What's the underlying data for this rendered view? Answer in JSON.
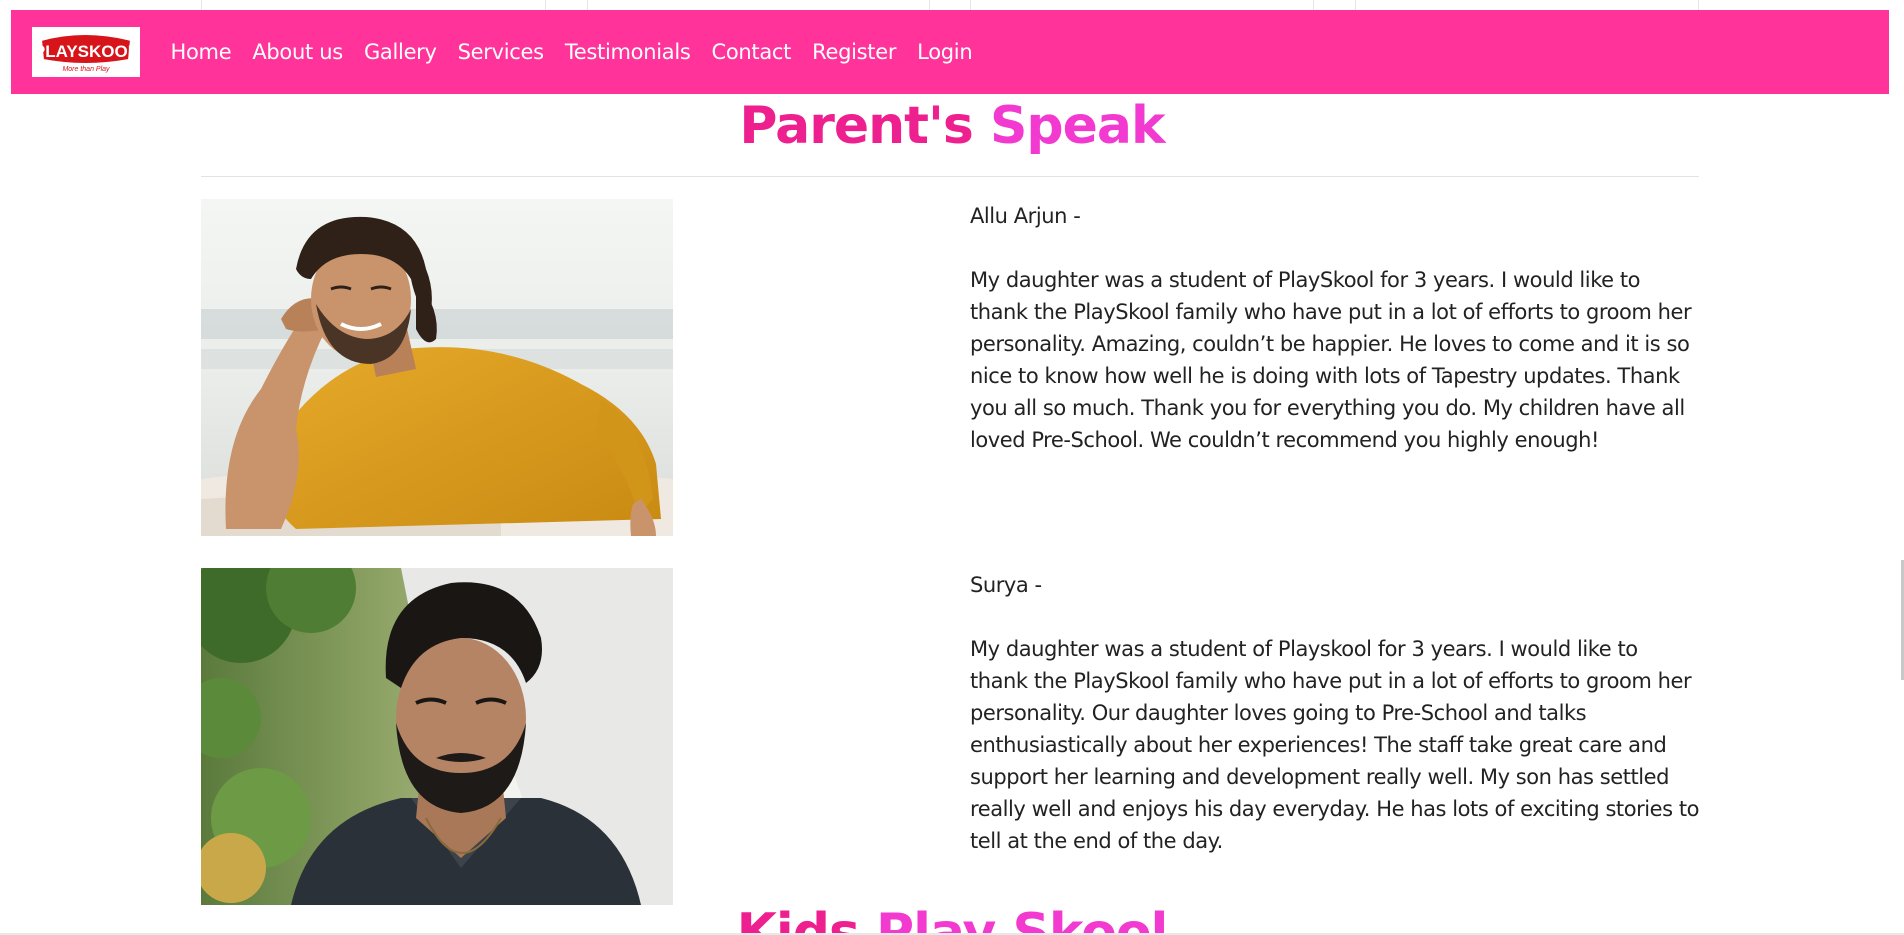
{
  "navbar": {
    "logo_text": "PLAYSKOOL",
    "logo_tagline": "More than Play",
    "links": [
      "Home",
      "About us",
      "Gallery",
      "Services",
      "Testimonials",
      "Contact",
      "Register",
      "Login"
    ]
  },
  "testimonials_section": {
    "title_main": "Parent's",
    "title_accent": "Speak",
    "items": [
      {
        "author": "Allu Arjun -",
        "text": "My daughter was a student of PlaySkool for 3 years. I would like to thank the PlaySkool family who have put in a lot of efforts to groom her personality. Amazing, couldn’t be happier. He loves to come and it is so nice to know how well he is doing with lots of Tapestry updates. Thank you all so much. Thank you for everything you do. My children have all loved Pre-School. We couldn’t recommend you highly enough!"
      },
      {
        "author": "Surya -",
        "text": "My daughter was a student of Playskool for 3 years. I would like to thank the PlaySkool family who have put in a lot of efforts to groom her personality. Our daughter loves going to Pre-School and talks enthusiastically about her experiences! The staff take great care and support her learning and development really well. My son has settled really well and enjoys his day everyday. He has lots of exciting stories to tell at the end of the day."
      }
    ]
  },
  "next_section": {
    "title_main": "Kids",
    "title_accent": "Play Skool"
  },
  "colors": {
    "nav_background": "#ff3399",
    "title_primary": "#ee1f8e",
    "title_accent": "#f23ad1",
    "logo_red": "#d7141a"
  }
}
